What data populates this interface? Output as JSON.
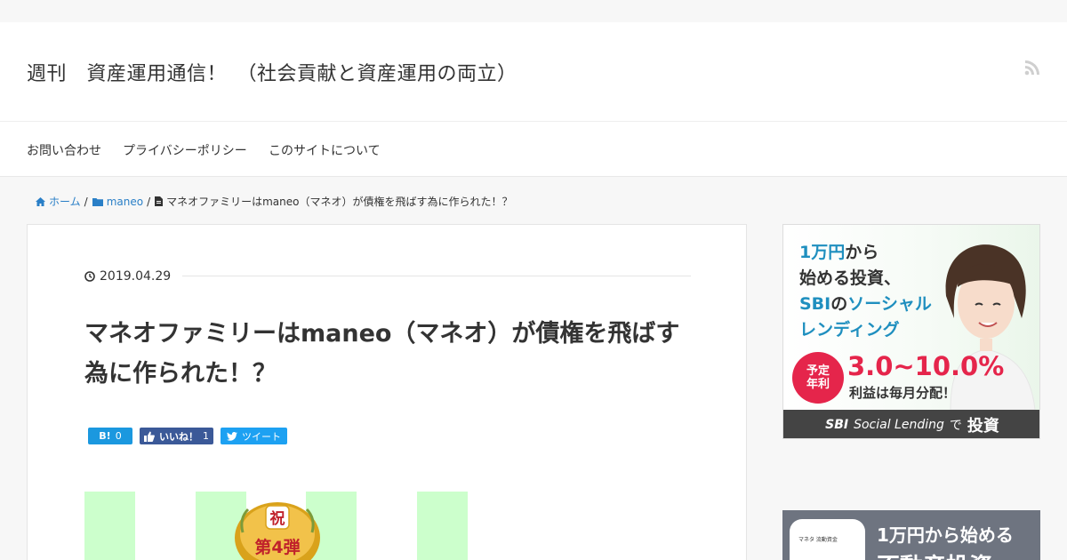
{
  "header": {
    "site_title": "週刊　資産運用通信！　（社会貢献と資産運用の両立）"
  },
  "nav": {
    "items": [
      {
        "label": "お問い合わせ"
      },
      {
        "label": "プライバシーポリシー"
      },
      {
        "label": "このサイトについて"
      }
    ]
  },
  "breadcrumb": {
    "home": "ホーム",
    "category": "maneo",
    "current": "マネオファミリーはmaneo（マネオ）が債権を飛ばす為に作られた！？",
    "separator": "/"
  },
  "article": {
    "date": "2019.04.29",
    "title": "マネオファミリーはmaneo（マネオ）が債権を飛ばす為に作られた！？",
    "share": {
      "hatena_label": "B!",
      "hatena_count": "0",
      "fb_label": "いいね！",
      "fb_count": "1",
      "tw_label": "ツイート"
    },
    "image": {
      "stripe_color": "#ccffcc",
      "badge_top": "祝",
      "badge_main": "第4弾"
    }
  },
  "sidebar": {
    "ad1": {
      "line1_blue": "1万円",
      "line1_dark": "から",
      "line2": "始める投資、",
      "line3_blue": "SBI",
      "line3_dark": "の",
      "line3_blue2": "ソーシャル",
      "line4": "レンディング",
      "circle_top": "予定",
      "circle_bottom": "年利",
      "rate": "3.0~10.0%",
      "monthly": "利益は毎月分配！",
      "footer_brand": "SBI",
      "footer_text": "Social Lending",
      "footer_de": "で",
      "footer_invest": "投資"
    },
    "ad2": {
      "phone_text": "マネタ 流動資金",
      "text1": "1万円から始める",
      "text2": "不動産投資"
    }
  },
  "colors": {
    "link": "#2a7fc7",
    "hatena": "#1b98df",
    "facebook": "#3b5998",
    "twitter": "#1da1f2",
    "accent_red": "#e5254b",
    "ad_blue": "#1f8fbf"
  }
}
